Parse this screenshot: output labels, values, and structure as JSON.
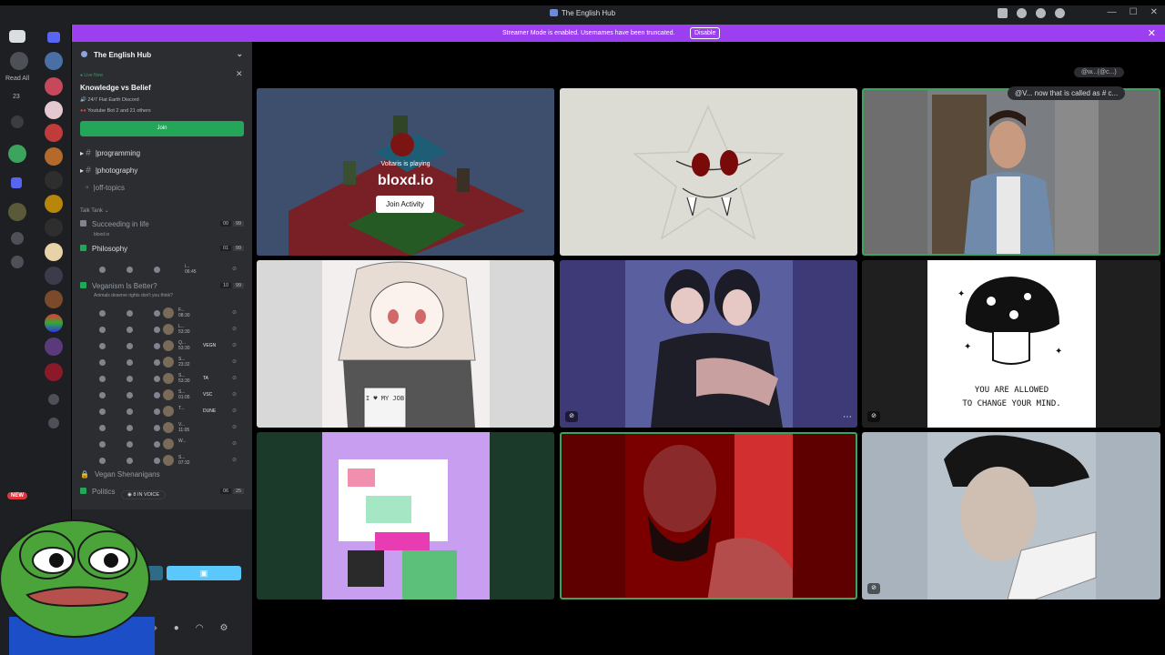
{
  "window": {
    "title": "The English Hub"
  },
  "banner": {
    "text": "Streamer Mode is enabled. Usernames have been truncated.",
    "disable_label": "Disable",
    "close": "✕"
  },
  "rail": {
    "read_all": "Read All",
    "badge": "23"
  },
  "server": {
    "name": "The English Hub",
    "live": {
      "label": "Live Now",
      "title": "Knowledge vs Belief",
      "subtitle": "24/7 Flat Earth Discord",
      "users": "Youtube Bot 2  and 21 others",
      "join_label": "Join"
    },
    "channels": [
      {
        "name": "programming"
      },
      {
        "name": "photography"
      },
      {
        "name": "off-topics"
      }
    ],
    "category": "Talk Tank",
    "voice": [
      {
        "name": "Succeeding in life",
        "sub": "bloxd.io",
        "count_a": "00",
        "count_b": "99"
      },
      {
        "name": "Philosophy",
        "count_a": "01",
        "count_b": "99"
      },
      {
        "name": "Veganism Is Better?",
        "sub": "Animals deserve rights don't you think?",
        "count_a": "10",
        "count_b": "99"
      }
    ],
    "philosophy_user": {
      "name": "i...",
      "time": "06:45"
    },
    "vegan_users": [
      {
        "name": "F...",
        "time": "08:30",
        "tag": ""
      },
      {
        "name": "L...",
        "time": "53:30",
        "tag": ""
      },
      {
        "name": "Q...",
        "time": "53:30",
        "tag": "VEGN"
      },
      {
        "name": "S...",
        "time": "23:32",
        "tag": ""
      },
      {
        "name": "S...",
        "time": "53:30",
        "tag": "TA"
      },
      {
        "name": "S...",
        "time": "01:05",
        "tag": "VSC"
      },
      {
        "name": "T...",
        "time": "",
        "tag": "DUNE"
      },
      {
        "name": "V...",
        "time": "11:05",
        "tag": ""
      },
      {
        "name": "W...",
        "time": "",
        "tag": ""
      },
      {
        "name": "S...",
        "time": "07:32",
        "tag": ""
      }
    ],
    "locked_channel": "Vegan Shenanigans",
    "politics": {
      "name": "Politics",
      "count_a": "06",
      "count_b": "25"
    },
    "in_voice_pill": "8 IN VOICE",
    "new_badge": "NEW"
  },
  "main": {
    "chat_pill": "@w...(@c...)",
    "chat_tooltip": "@V... now that is called as # c...",
    "activity": {
      "playing_label": "Voltaris is playing",
      "game": "bloxd.io",
      "join_label": "Join Activity"
    },
    "allowed_text_1": "YOU ARE ALLOWED",
    "allowed_text_2": "TO CHANGE YOUR MIND.",
    "mug_text": "I ♥ MY JOB"
  },
  "colors": {
    "accent_purple": "#9b3ff0",
    "join_green": "#23a55a",
    "speaking_border": "#3ba55d",
    "activity_button": "#5ac8fa"
  }
}
